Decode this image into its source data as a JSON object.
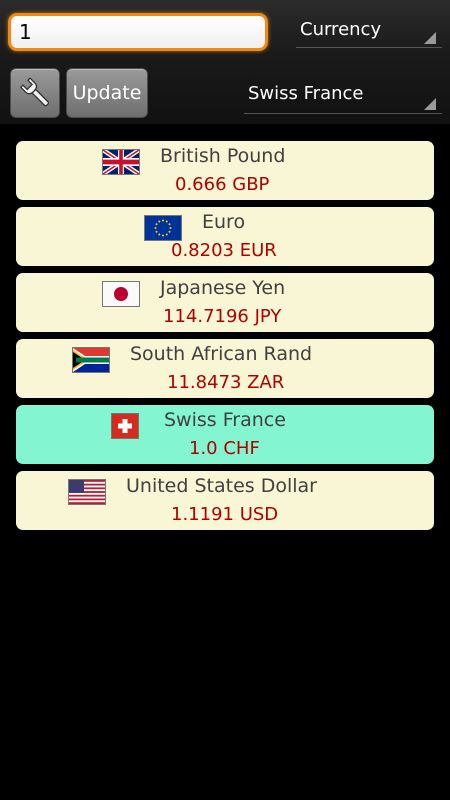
{
  "input": {
    "value": "1"
  },
  "type_spinner": {
    "selected": "Currency"
  },
  "base_spinner": {
    "selected": "Swiss France"
  },
  "toolbar": {
    "update_label": "Update",
    "settings_icon": "wrench-icon"
  },
  "currencies": [
    {
      "name": "British Pound",
      "amount": "0.666 GBP",
      "flag": "uk-flag-icon",
      "selected": false
    },
    {
      "name": "Euro",
      "amount": "0.8203 EUR",
      "flag": "eu-flag-icon",
      "selected": false
    },
    {
      "name": "Japanese Yen",
      "amount": "114.7196 JPY",
      "flag": "japan-flag-icon",
      "selected": false
    },
    {
      "name": "South African Rand",
      "amount": "11.8473 ZAR",
      "flag": "south-africa-flag-icon",
      "selected": false
    },
    {
      "name": "Swiss France",
      "amount": "1.0 CHF",
      "flag": "swiss-flag-icon",
      "selected": true
    },
    {
      "name": "United States Dollar",
      "amount": "1.1191 USD",
      "flag": "us-flag-icon",
      "selected": false
    }
  ],
  "colors": {
    "input_border": "#f08a12",
    "row_background": "#f8f6d4",
    "row_selected": "#84f5d1",
    "amount_text": "#b00000"
  }
}
